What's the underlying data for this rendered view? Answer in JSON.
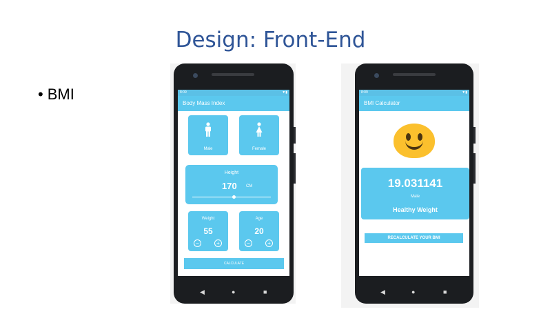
{
  "slide": {
    "title": "Design: Front-End",
    "bullet": "BMI"
  },
  "phone1": {
    "status_time": "8:09",
    "app_title": "Body Mass Index",
    "male_label": "Male",
    "female_label": "Female",
    "height_label": "Height",
    "height_value": "170",
    "height_unit": "CM",
    "height_slider_fraction": 0.53,
    "weight_label": "Weight",
    "weight_value": "55",
    "age_label": "Age",
    "age_value": "20",
    "minus_symbol": "−",
    "plus_symbol": "+",
    "calculate_label": "CALCULATE",
    "nav": {
      "back": "◀",
      "home": "●",
      "recent": "■"
    }
  },
  "phone2": {
    "status_time": "8:09",
    "app_title": "BMI Calculator",
    "emoji_icon": "smiling-face-icon",
    "bmi_value": "19.031141",
    "gender": "Male",
    "result_status": "Healthy Weight",
    "recalculate_label": "RECALCULATE YOUR BMI",
    "nav": {
      "back": "◀",
      "home": "●",
      "recent": "■"
    }
  },
  "colors": {
    "accent": "#5bc8ee",
    "title": "#2f5597",
    "emoji": "#fbc02d"
  }
}
